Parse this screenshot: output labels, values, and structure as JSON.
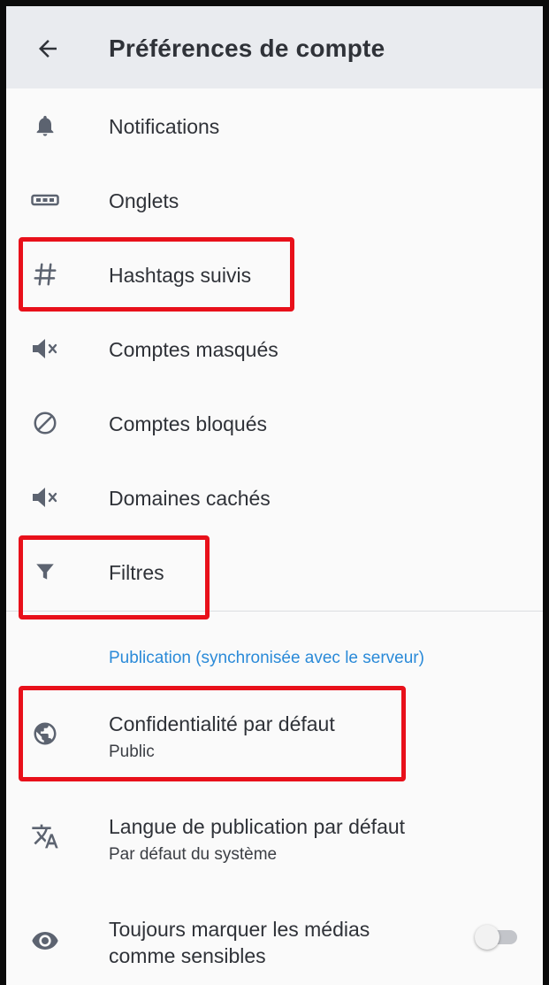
{
  "header": {
    "title": "Préférences de compte",
    "back_icon": "arrow-back-icon"
  },
  "menu": [
    {
      "label": "Notifications",
      "icon": "bell-icon"
    },
    {
      "label": "Onglets",
      "icon": "tabs-icon"
    },
    {
      "label": "Hashtags suivis",
      "icon": "hashtag-icon",
      "highlighted": true
    },
    {
      "label": "Comptes masqués",
      "icon": "volume-off-icon"
    },
    {
      "label": "Comptes bloqués",
      "icon": "block-icon"
    },
    {
      "label": "Domaines cachés",
      "icon": "volume-off-icon"
    },
    {
      "label": "Filtres",
      "icon": "filter-icon",
      "highlighted": true
    }
  ],
  "publishing": {
    "section_title": "Publication (synchronisée avec le serveur)",
    "privacy": {
      "label": "Confidentialité par défaut",
      "value": "Public",
      "icon": "globe-icon",
      "highlighted": true
    },
    "language": {
      "label": "Langue de publication par défaut",
      "value": "Par défaut du système",
      "icon": "translate-icon"
    },
    "sensitive": {
      "label_line1": "Toujours marquer les médias",
      "label_line2": "comme sensibles",
      "icon": "eye-icon",
      "enabled": false
    }
  },
  "colors": {
    "appbar": "#e9ebef",
    "background": "#fafafa",
    "text": "#2f3238",
    "icon": "#5c6370",
    "section_accent": "#2a8ad8",
    "highlight": "#e8101a"
  }
}
